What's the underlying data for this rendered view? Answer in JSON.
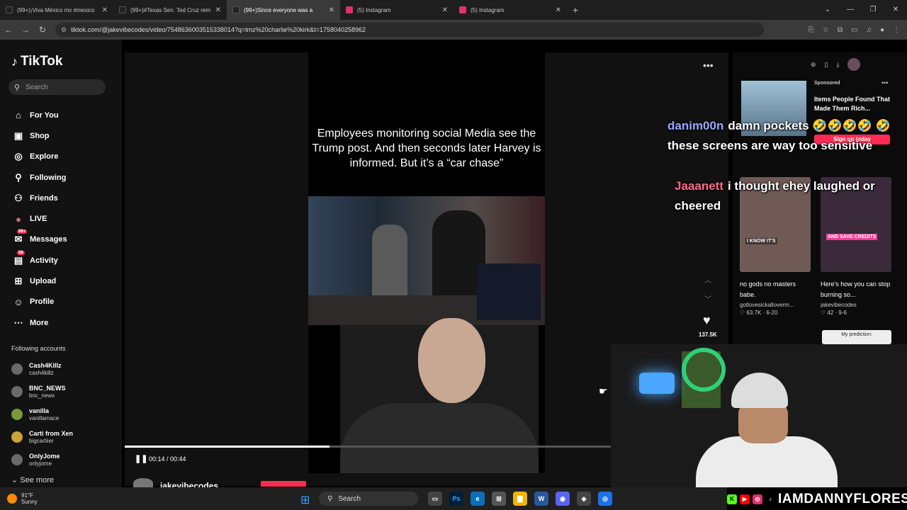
{
  "browser": {
    "tabs": [
      {
        "title": "(99+)¡Viva México mx #mexico",
        "color": "#ffffff"
      },
      {
        "title": "(99+)#Texas Sen. Ted Cruz rem",
        "color": "#ffffff"
      },
      {
        "title": "(99+)Since everyone was a",
        "color": "#ffffff"
      },
      {
        "title": "(5) Instagram",
        "color": "#e1306c"
      },
      {
        "title": "(5) Instagram",
        "color": "#e1306c"
      }
    ],
    "url": "tiktok.com/@jakevibecodes/video/7548636003515338014?q=tmz%20charlie%20kirk&t=1758040258962"
  },
  "sidebar": {
    "logo": "TikTok",
    "search_placeholder": "Search",
    "nav": [
      {
        "label": "For You",
        "icon": "home-icon",
        "glyph": "⌂"
      },
      {
        "label": "Shop",
        "icon": "shop-icon",
        "glyph": "🛍"
      },
      {
        "label": "Explore",
        "icon": "compass-icon",
        "glyph": "◎"
      },
      {
        "label": "Following",
        "icon": "following-icon",
        "glyph": "⚲"
      },
      {
        "label": "Friends",
        "icon": "friends-icon",
        "glyph": "⚇"
      },
      {
        "label": "LIVE",
        "icon": "live-icon",
        "glyph": "●"
      },
      {
        "label": "Messages",
        "icon": "messages-icon",
        "glyph": "✉",
        "badge": "99+"
      },
      {
        "label": "Activity",
        "icon": "activity-icon",
        "glyph": "▤",
        "badge": "58"
      },
      {
        "label": "Upload",
        "icon": "upload-icon",
        "glyph": "⊞"
      },
      {
        "label": "Profile",
        "icon": "profile-icon",
        "glyph": "☺"
      },
      {
        "label": "More",
        "icon": "more-icon",
        "glyph": "⋯"
      }
    ],
    "following_accounts_label": "Following accounts",
    "accounts": [
      {
        "name": "Cash4Killz",
        "handle": "cash4killz"
      },
      {
        "name": "BNC_NEWS",
        "handle": "bnc_news"
      },
      {
        "name": "vanilla",
        "handle": "vanillamace"
      },
      {
        "name": "Carti from Xen",
        "handle": "bigcartiier"
      },
      {
        "name": "OnlyJome",
        "handle": "onlyjome"
      }
    ],
    "see_more": "See more"
  },
  "video": {
    "caption": "Employees monitoring social Media see the Trump post. And then seconds later Harvey is informed. But it’s a “car chase”",
    "time": "00:14 / 00:44",
    "progress": 0.42,
    "author": "jakevibecodes",
    "likes": "137.5K"
  },
  "right": {
    "sponsored": "Sponsored",
    "ad_title": "Items People Found That Made Them Rich...",
    "signup": "Sign up today",
    "cards": [
      {
        "thumb_label": "I KNOW IT'S",
        "title": "no gods no masters babe.",
        "author": "gotlovesickalloverm...",
        "meta": "♡ 63.7K · 6-20"
      },
      {
        "thumb_label": "AND SAVE CREDITS",
        "title": "Here's how you can stop burning so...",
        "author": "jakevibecodes",
        "meta": "♡ 42 · 9-6"
      }
    ],
    "prediction": "My prediction:"
  },
  "chat": [
    {
      "user": "danim00n",
      "message": "damn pockets 🤣🤣🤣🤣 🤣 these screens are way too sensitive"
    },
    {
      "user": "Jaaanett",
      "message": "i thought ehey laughed or cheered"
    }
  ],
  "stream": {
    "handle": "IAMDANNYFLORES"
  },
  "taskbar": {
    "temp": "91°F",
    "weather": "Sunny",
    "search": "Search"
  }
}
